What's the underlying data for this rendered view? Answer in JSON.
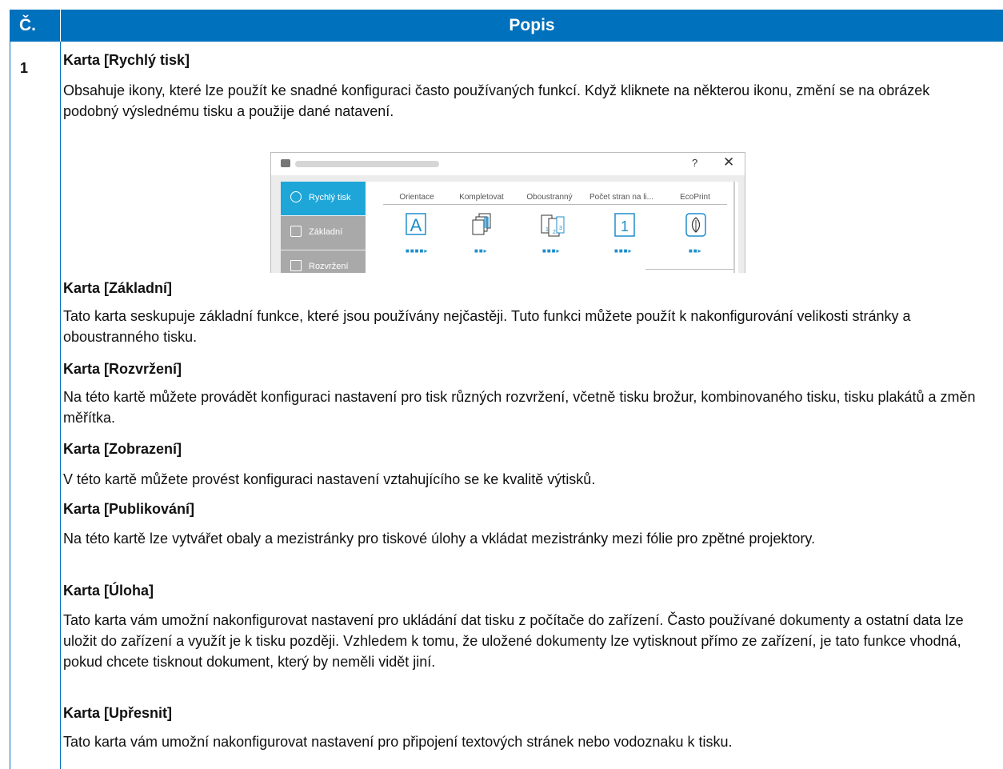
{
  "table": {
    "col_no_header": "Č.",
    "col_desc_header": "Popis",
    "row_number": "1"
  },
  "sections": {
    "quick_print": {
      "heading": "Karta [Rychlý tisk]",
      "text": "Obsahuje ikony, které lze použít ke snadné konfiguraci často používaných funkcí. Když kliknete na některou ikonu, změní se na obrázek podobný výslednému tisku a použije dané natavení."
    },
    "basic": {
      "heading": "Karta [Základní]",
      "text": "Tato karta seskupuje základní funkce, které jsou používány nejčastěji. Tuto funkci můžete použít k nakonfigurování velikosti stránky a oboustranného tisku."
    },
    "layout": {
      "heading": "Karta [Rozvržení]",
      "text": "Na této kartě můžete provádět konfiguraci nastavení pro tisk různých rozvržení, včetně tisku brožur, kombinovaného tisku, tisku plakátů a změn měřítka."
    },
    "imaging": {
      "heading": "Karta [Zobrazení]",
      "text": "V této kartě můžete provést konfiguraci nastavení vztahujícího se ke kvalitě výtisků."
    },
    "publishing": {
      "heading": "Karta [Publikování]",
      "text": "Na této kartě lze vytvářet obaly a mezistránky pro tiskové úlohy a vkládat mezistránky mezi fólie pro zpětné projektory."
    },
    "job": {
      "heading": "Karta [Úloha]",
      "text": "Tato karta vám umožní nakonfigurovat nastavení pro ukládání dat tisku z počítače do zařízení. Často používané dokumenty a ostatní data lze uložit do zařízení a využít je k tisku později. Vzhledem k tomu, že uložené dokumenty lze vytisknout přímo ze zařízení, je tato funkce vhodná, pokud chcete tisknout dokument, který by neměli vidět jiní."
    },
    "advanced": {
      "heading": "Karta [Upřesnit]",
      "text": "Tato karta vám umožní nakonfigurovat nastavení pro připojení textových stránek nebo vodoznaku k tisku."
    }
  },
  "screenshot": {
    "help_glyph": "?",
    "close_glyph": "✕",
    "sidebar": [
      {
        "label": "Rychlý tisk",
        "icon": "clock-icon"
      },
      {
        "label": "Základní",
        "icon": "document-icon"
      },
      {
        "label": "Rozvržení",
        "icon": "layout-grid-icon"
      }
    ],
    "functions": [
      {
        "label": "Orientace",
        "icon": "orientation-a-icon",
        "glyph": "A"
      },
      {
        "label": "Kompletovat",
        "icon": "collate-icon",
        "glyph": ""
      },
      {
        "label": "Oboustranný",
        "icon": "duplex-icon",
        "glyph": ""
      },
      {
        "label": "Počet stran na li...",
        "icon": "pages-per-sheet-icon",
        "glyph": "1"
      },
      {
        "label": "EcoPrint",
        "icon": "leaf-icon",
        "glyph": ""
      }
    ],
    "colors": {
      "accent": "#1fa6d8",
      "sidebar": "#a9a9a9",
      "header": "#0071bc"
    }
  }
}
